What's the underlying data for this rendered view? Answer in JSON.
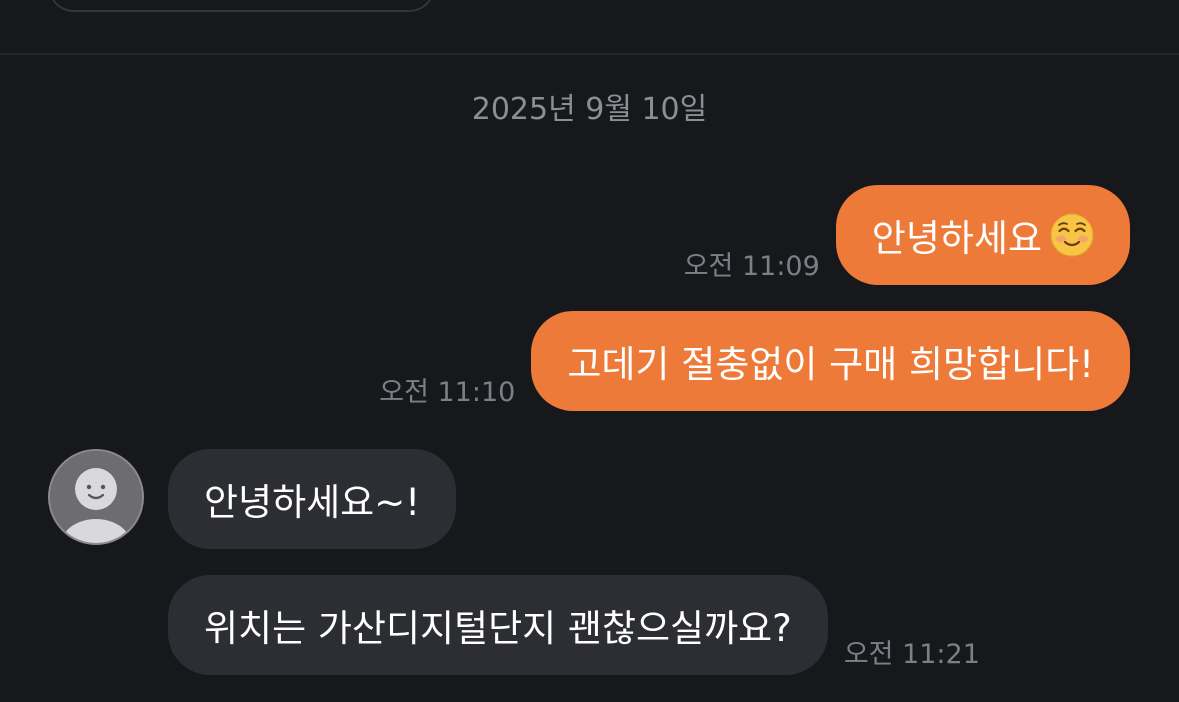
{
  "header": {},
  "chat": {
    "date_separator": "2025년 9월 10일",
    "messages": [
      {
        "direction": "outgoing",
        "text": "안녕하세요",
        "emoji": "smiling-face-emoji",
        "time": "오전 11:09"
      },
      {
        "direction": "outgoing",
        "text": "고데기 절충없이 구매 희망합니다!",
        "time": "오전 11:10"
      },
      {
        "direction": "incoming",
        "text": "안녕하세요~!",
        "time": ""
      },
      {
        "direction": "incoming",
        "text": "위치는 가산디지털단지 괜찮으실까요?",
        "time": "오전 11:21"
      }
    ]
  },
  "colors": {
    "background": "#17181c",
    "outgoing_bubble": "#ee7a3a",
    "incoming_bubble": "#2c2e33",
    "timestamp": "#7d7f86",
    "date_separator": "#8c8e94"
  },
  "icons": {
    "avatar": "default-profile-avatar-icon"
  }
}
